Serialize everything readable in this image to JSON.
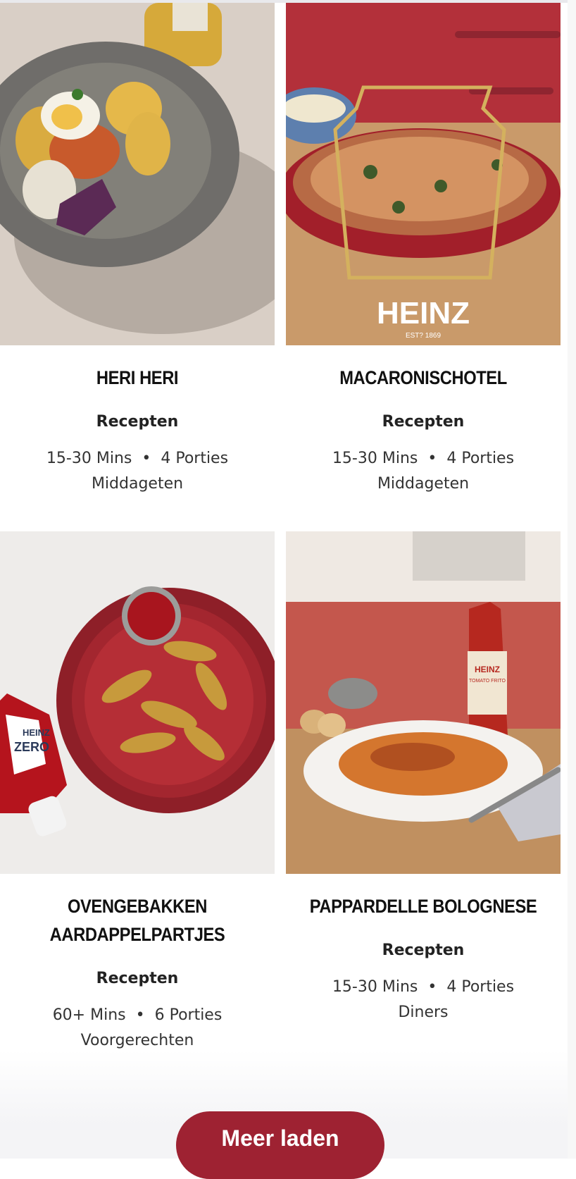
{
  "recipes": [
    {
      "title": "HERI HERI",
      "category": "Recepten",
      "time": "15-30 Mins",
      "servings": "4 Porties",
      "course": "Middageten",
      "image_icon": "plate-plantains-egg-image"
    },
    {
      "title": "MACARONISCHOTEL",
      "category": "Recepten",
      "time": "15-30 Mins",
      "servings": "4 Porties",
      "course": "Middageten",
      "image_icon": "macaroni-casserole-image",
      "logo_text": "HEINZ",
      "logo_sub": "EST? 1869"
    },
    {
      "title_lines": [
        "OVENGEBAKKEN",
        "AARDAPPELPARTJES"
      ],
      "category": "Recepten",
      "time": "60+ Mins",
      "servings": "6 Porties",
      "course": "Voorgerechten",
      "image_icon": "potato-wedges-ketchup-image",
      "bottle_text": [
        "HEINZ",
        "ZERO"
      ]
    },
    {
      "title": "PAPPARDELLE BOLOGNESE",
      "category": "Recepten",
      "time": "15-30 Mins",
      "servings": "4 Porties",
      "course": "Diners",
      "image_icon": "pappardelle-bolognese-image",
      "bottle_text": [
        "HEINZ",
        "TOMATO FRITO"
      ]
    }
  ],
  "separator": "•",
  "load_more_label": "Meer laden",
  "colors": {
    "accent": "#9e2232",
    "text": "#1b1b1b"
  }
}
